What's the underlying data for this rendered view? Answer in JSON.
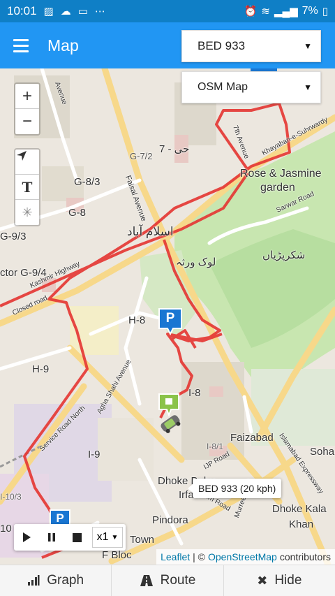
{
  "status_bar": {
    "time": "10:01",
    "battery": "7%",
    "icons": [
      "photo-icon",
      "cloud-icon",
      "monitor-icon",
      "more-icon",
      "alarm-icon",
      "wifi-icon",
      "signal-icon",
      "battery-icon"
    ]
  },
  "app_bar": {
    "title": "Map",
    "vehicle_select": "BED 933",
    "layer_select": "OSM Map"
  },
  "map": {
    "labels": {
      "g72": "G-7/2",
      "g7": "حی - 7",
      "g83": "G-8/3",
      "g8": "G-8",
      "g93": "G-9/3",
      "sector_g94": "ctor G-9/4",
      "islamabad": "اسلام آباد",
      "lok_virsa": "لوک ورثہ",
      "shakarparian": "شکرپڑیاں",
      "rose_jasmine_1": "Rose & Jasmine",
      "rose_jasmine_2": "garden",
      "h8": "H-8",
      "h9": "H-9",
      "i8": "I-8",
      "i9": "I-9",
      "i81": "I-8/1",
      "i103": "I-10/3",
      "faizabad": "Faizabad",
      "dhoke_babu": "Dhoke Babu",
      "irfan": "Irfan",
      "pindora": "Pindora",
      "town": "Town",
      "dhoke_kala_1": "Dhoke Kala",
      "dhoke_kala_2": "Khan",
      "f_bloc": "F Bloc",
      "sohan": "Soha",
      "ten": "10",
      "faisal_avenue": "Faisal Avenue",
      "seventh_avenue": "7th Avenue",
      "khayaban": "Khayaban-e-Suhrwardy",
      "kashmir_highway": "Kashmir Highway",
      "closed_road": "Closed road",
      "agha_shahi": "Agha Shahi Avenue",
      "service_road": "Service Road North",
      "sarwar_road": "Sarwar Road",
      "ijp_road": "IJP Road",
      "stadium_road": "Stadium Road",
      "murree_road": "Murree Road",
      "islamabad_expressway": "Islamabad Expressway",
      "avenue": "Avenue"
    },
    "parking_label": "P",
    "popup": "BED 933 (20 kph)"
  },
  "controls": {
    "zoom_in": "+",
    "zoom_out": "−",
    "text_tool": "T",
    "speed": "x1"
  },
  "attribution": {
    "leaflet": "Leaflet",
    "sep": "| ©",
    "osm": "OpenStreetMap",
    "contributors": "contributors"
  },
  "bottom_bar": {
    "graph": "Graph",
    "route": "Route",
    "hide": "Hide"
  },
  "colors": {
    "status_bar": "#0f7fc6",
    "app_bar": "#2196f3",
    "route": "#e53935",
    "parking_marker": "#1976d2",
    "vehicle_marker": "#8bc34a",
    "park_green": "#c8e6b0"
  }
}
